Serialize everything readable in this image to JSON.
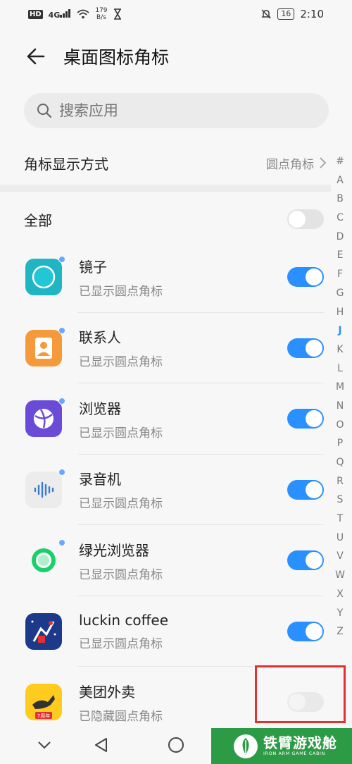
{
  "status_bar": {
    "hd": "HD",
    "network": "4G",
    "speed_value": "179",
    "speed_unit": "B/s",
    "battery": "16",
    "time": "2:10"
  },
  "header": {
    "title": "桌面图标角标"
  },
  "search": {
    "placeholder": "搜索应用"
  },
  "badge_display": {
    "label": "角标显示方式",
    "value": "圆点角标"
  },
  "all_toggle": {
    "label": "全部",
    "state": "off"
  },
  "apps": [
    {
      "name": "镜子",
      "status": "已显示圆点角标",
      "icon": "mirror-icon",
      "toggle": "on",
      "badge": true
    },
    {
      "name": "联系人",
      "status": "已显示圆点角标",
      "icon": "contacts-icon",
      "toggle": "on",
      "badge": true
    },
    {
      "name": "浏览器",
      "status": "已显示圆点角标",
      "icon": "browser-icon",
      "toggle": "on",
      "badge": true
    },
    {
      "name": "录音机",
      "status": "已显示圆点角标",
      "icon": "recorder-icon",
      "toggle": "on",
      "badge": true
    },
    {
      "name": "绿光浏览器",
      "status": "已显示圆点角标",
      "icon": "green-browser-icon",
      "toggle": "on",
      "badge": true
    },
    {
      "name": "luckin coffee",
      "status": "已显示圆点角标",
      "icon": "luckin-coffee-icon",
      "toggle": "on",
      "badge": false
    },
    {
      "name": "美团外卖",
      "status": "已隐藏圆点角标",
      "icon": "meituan-icon",
      "toggle": "off",
      "badge": false,
      "icon_caption": "7周年"
    }
  ],
  "alpha_index": [
    "#",
    "A",
    "B",
    "C",
    "D",
    "E",
    "F",
    "G",
    "H",
    "J",
    "K",
    "L",
    "M",
    "N",
    "O",
    "P",
    "Q",
    "R",
    "S",
    "T",
    "U",
    "V",
    "W",
    "X",
    "Y",
    "Z"
  ],
  "alpha_active": "J",
  "watermark": {
    "main": "铁臂游戏舱",
    "sub": "IRON ARM GAME CABIN"
  },
  "colors": {
    "accent": "#2a90ff",
    "highlight": "#e53030",
    "watermark_bg": "#2d9b45"
  }
}
